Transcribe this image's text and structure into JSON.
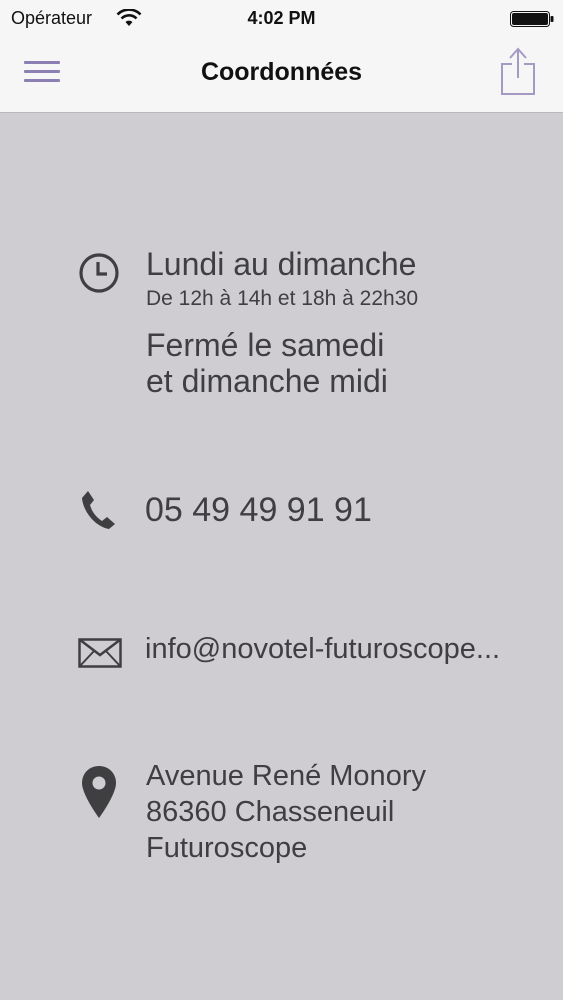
{
  "status_bar": {
    "carrier": "Opérateur",
    "time": "4:02 PM"
  },
  "nav": {
    "title": "Coordonnées",
    "menu_icon": "hamburger-icon",
    "share_icon": "share-icon",
    "accent_color": "#8c7fb3"
  },
  "hours": {
    "icon": "clock-icon",
    "title": "Lundi au dimanche",
    "schedule": "De 12h à 14h et 18h à 22h30",
    "closed_line1": "Fermé le samedi",
    "closed_line2": "et dimanche midi"
  },
  "phone": {
    "icon": "phone-icon",
    "number": "05 49 49 91 91"
  },
  "email": {
    "icon": "envelope-icon",
    "address": "info@novotel-futuroscope..."
  },
  "address": {
    "icon": "map-pin-icon",
    "line1": "Avenue René Monory",
    "line2": "86360 Chasseneuil",
    "line3": "Futuroscope"
  },
  "colors": {
    "background": "#cfcdd1",
    "text": "#3f3f42"
  }
}
